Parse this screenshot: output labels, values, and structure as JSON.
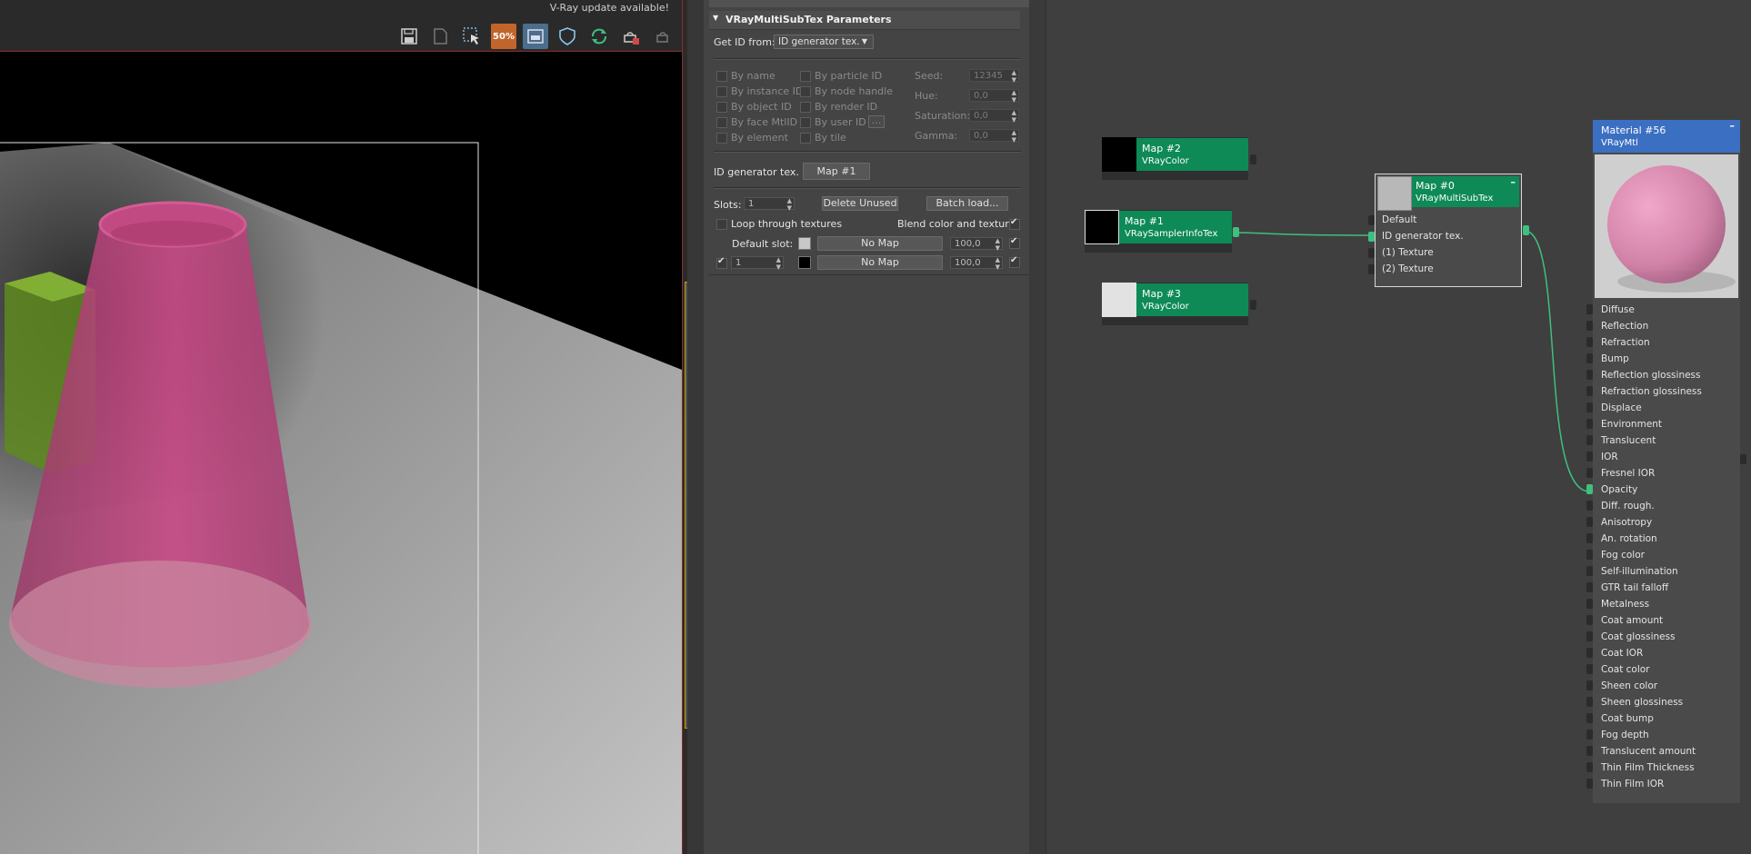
{
  "viewport": {
    "update_notice": "V-Ray update available!",
    "zoom_badge": "50%",
    "toolbar_icons": [
      "save-icon",
      "save-copy-icon",
      "region-select-icon",
      "zoom-badge-icon",
      "frame-icon",
      "shield-icon",
      "refresh-icon",
      "teapot-clear-icon",
      "teapot-icon"
    ]
  },
  "params": {
    "rollout_title": "VRayMultiSubTex Parameters",
    "get_id_label": "Get ID from:",
    "get_id_value": "ID generator tex.",
    "options_left": [
      "By name",
      "By instance ID",
      "By object ID",
      "By face MtlID",
      "By element"
    ],
    "options_mid": [
      "By particle ID",
      "By node handle",
      "By render ID",
      "By user ID",
      "By tile"
    ],
    "user_id_button": "...",
    "seed_label": "Seed:",
    "seed_value": "12345",
    "hue_label": "Hue:",
    "hue_value": "0,0",
    "saturation_label": "Saturation:",
    "saturation_value": "0,0",
    "gamma_label": "Gamma:",
    "gamma_value": "0,0",
    "id_gen_label": "ID generator tex.",
    "id_gen_button": "Map #1",
    "slots_label": "Slots:",
    "slots_value": "1",
    "delete_unused": "Delete Unused",
    "batch_load": "Batch load...",
    "loop_label": "Loop through textures",
    "blend_label": "Blend color and texture:",
    "default_slot_label": "Default slot:",
    "default_slot_map": "No Map",
    "default_slot_amount": "100,0",
    "slot1_id": "1",
    "slot1_map": "No Map",
    "slot1_amount": "100,0"
  },
  "nodes": {
    "map2": {
      "title": "Map #2",
      "type": "VRayColor"
    },
    "map1": {
      "title": "Map #1",
      "type": "VRaySamplerInfoTex"
    },
    "map3": {
      "title": "Map #3",
      "type": "VRayColor"
    },
    "map0": {
      "title": "Map #0",
      "type": "VRayMultiSubTex",
      "slots": [
        "Default",
        "ID generator tex.",
        "(1) Texture",
        "(2) Texture"
      ]
    },
    "material": {
      "title": "Material #56",
      "type": "VRayMtl",
      "slots": [
        "Diffuse",
        "Reflection",
        "Refraction",
        "Bump",
        "Reflection glossiness",
        "Refraction glossiness",
        "Displace",
        "Environment",
        "Translucent",
        "IOR",
        "Fresnel IOR",
        "Opacity",
        "Diff. rough.",
        "Anisotropy",
        "An. rotation",
        "Fog color",
        "Self-illumination",
        "GTR tail falloff",
        "Metalness",
        "Coat amount",
        "Coat glossiness",
        "Coat IOR",
        "Coat color",
        "Sheen color",
        "Sheen glossiness",
        "Coat bump",
        "Fog depth",
        "Translucent amount",
        "Thin Film Thickness",
        "Thin Film IOR"
      ],
      "connected_slot": "Opacity"
    }
  },
  "colors": {
    "node_header": "#0e8a57",
    "material_header": "#3b6fc2",
    "wire": "#3ec07e",
    "cone": "#c2477f",
    "box": "#5e8a1e"
  }
}
